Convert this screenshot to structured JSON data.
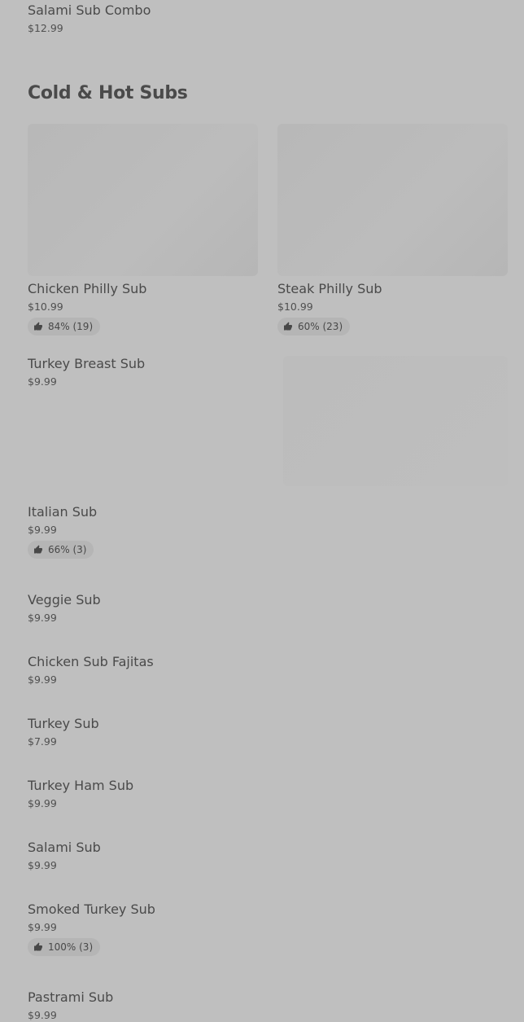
{
  "top_item": {
    "name": "Salami Sub Combo",
    "price": "$12.99"
  },
  "section": {
    "title": "Cold & Hot Subs"
  },
  "featured": [
    {
      "name": "Chicken Philly Sub",
      "price": "$10.99",
      "rating": "84% (19)"
    },
    {
      "name": "Steak Philly Sub",
      "price": "$10.99",
      "rating": "60% (23)"
    }
  ],
  "items": [
    {
      "name": "Turkey Breast Sub",
      "price": "$9.99"
    },
    {
      "name": "Italian Sub",
      "price": "$9.99",
      "rating": "66% (3)"
    },
    {
      "name": "Veggie Sub",
      "price": "$9.99"
    },
    {
      "name": "Chicken Sub Fajitas",
      "price": "$9.99"
    },
    {
      "name": "Turkey Sub",
      "price": "$7.99"
    },
    {
      "name": "Turkey Ham Sub",
      "price": "$9.99"
    },
    {
      "name": "Salami Sub",
      "price": "$9.99"
    },
    {
      "name": "Smoked Turkey Sub",
      "price": "$9.99",
      "rating": "100% (3)"
    },
    {
      "name": "Pastrami Sub",
      "price": "$9.99"
    }
  ],
  "icons": {
    "rating": "thumbs-up-icon"
  },
  "colors": {
    "overlay": "#bfbfbf",
    "badge": "#b5b5b5",
    "text": "#4a4a4a"
  }
}
